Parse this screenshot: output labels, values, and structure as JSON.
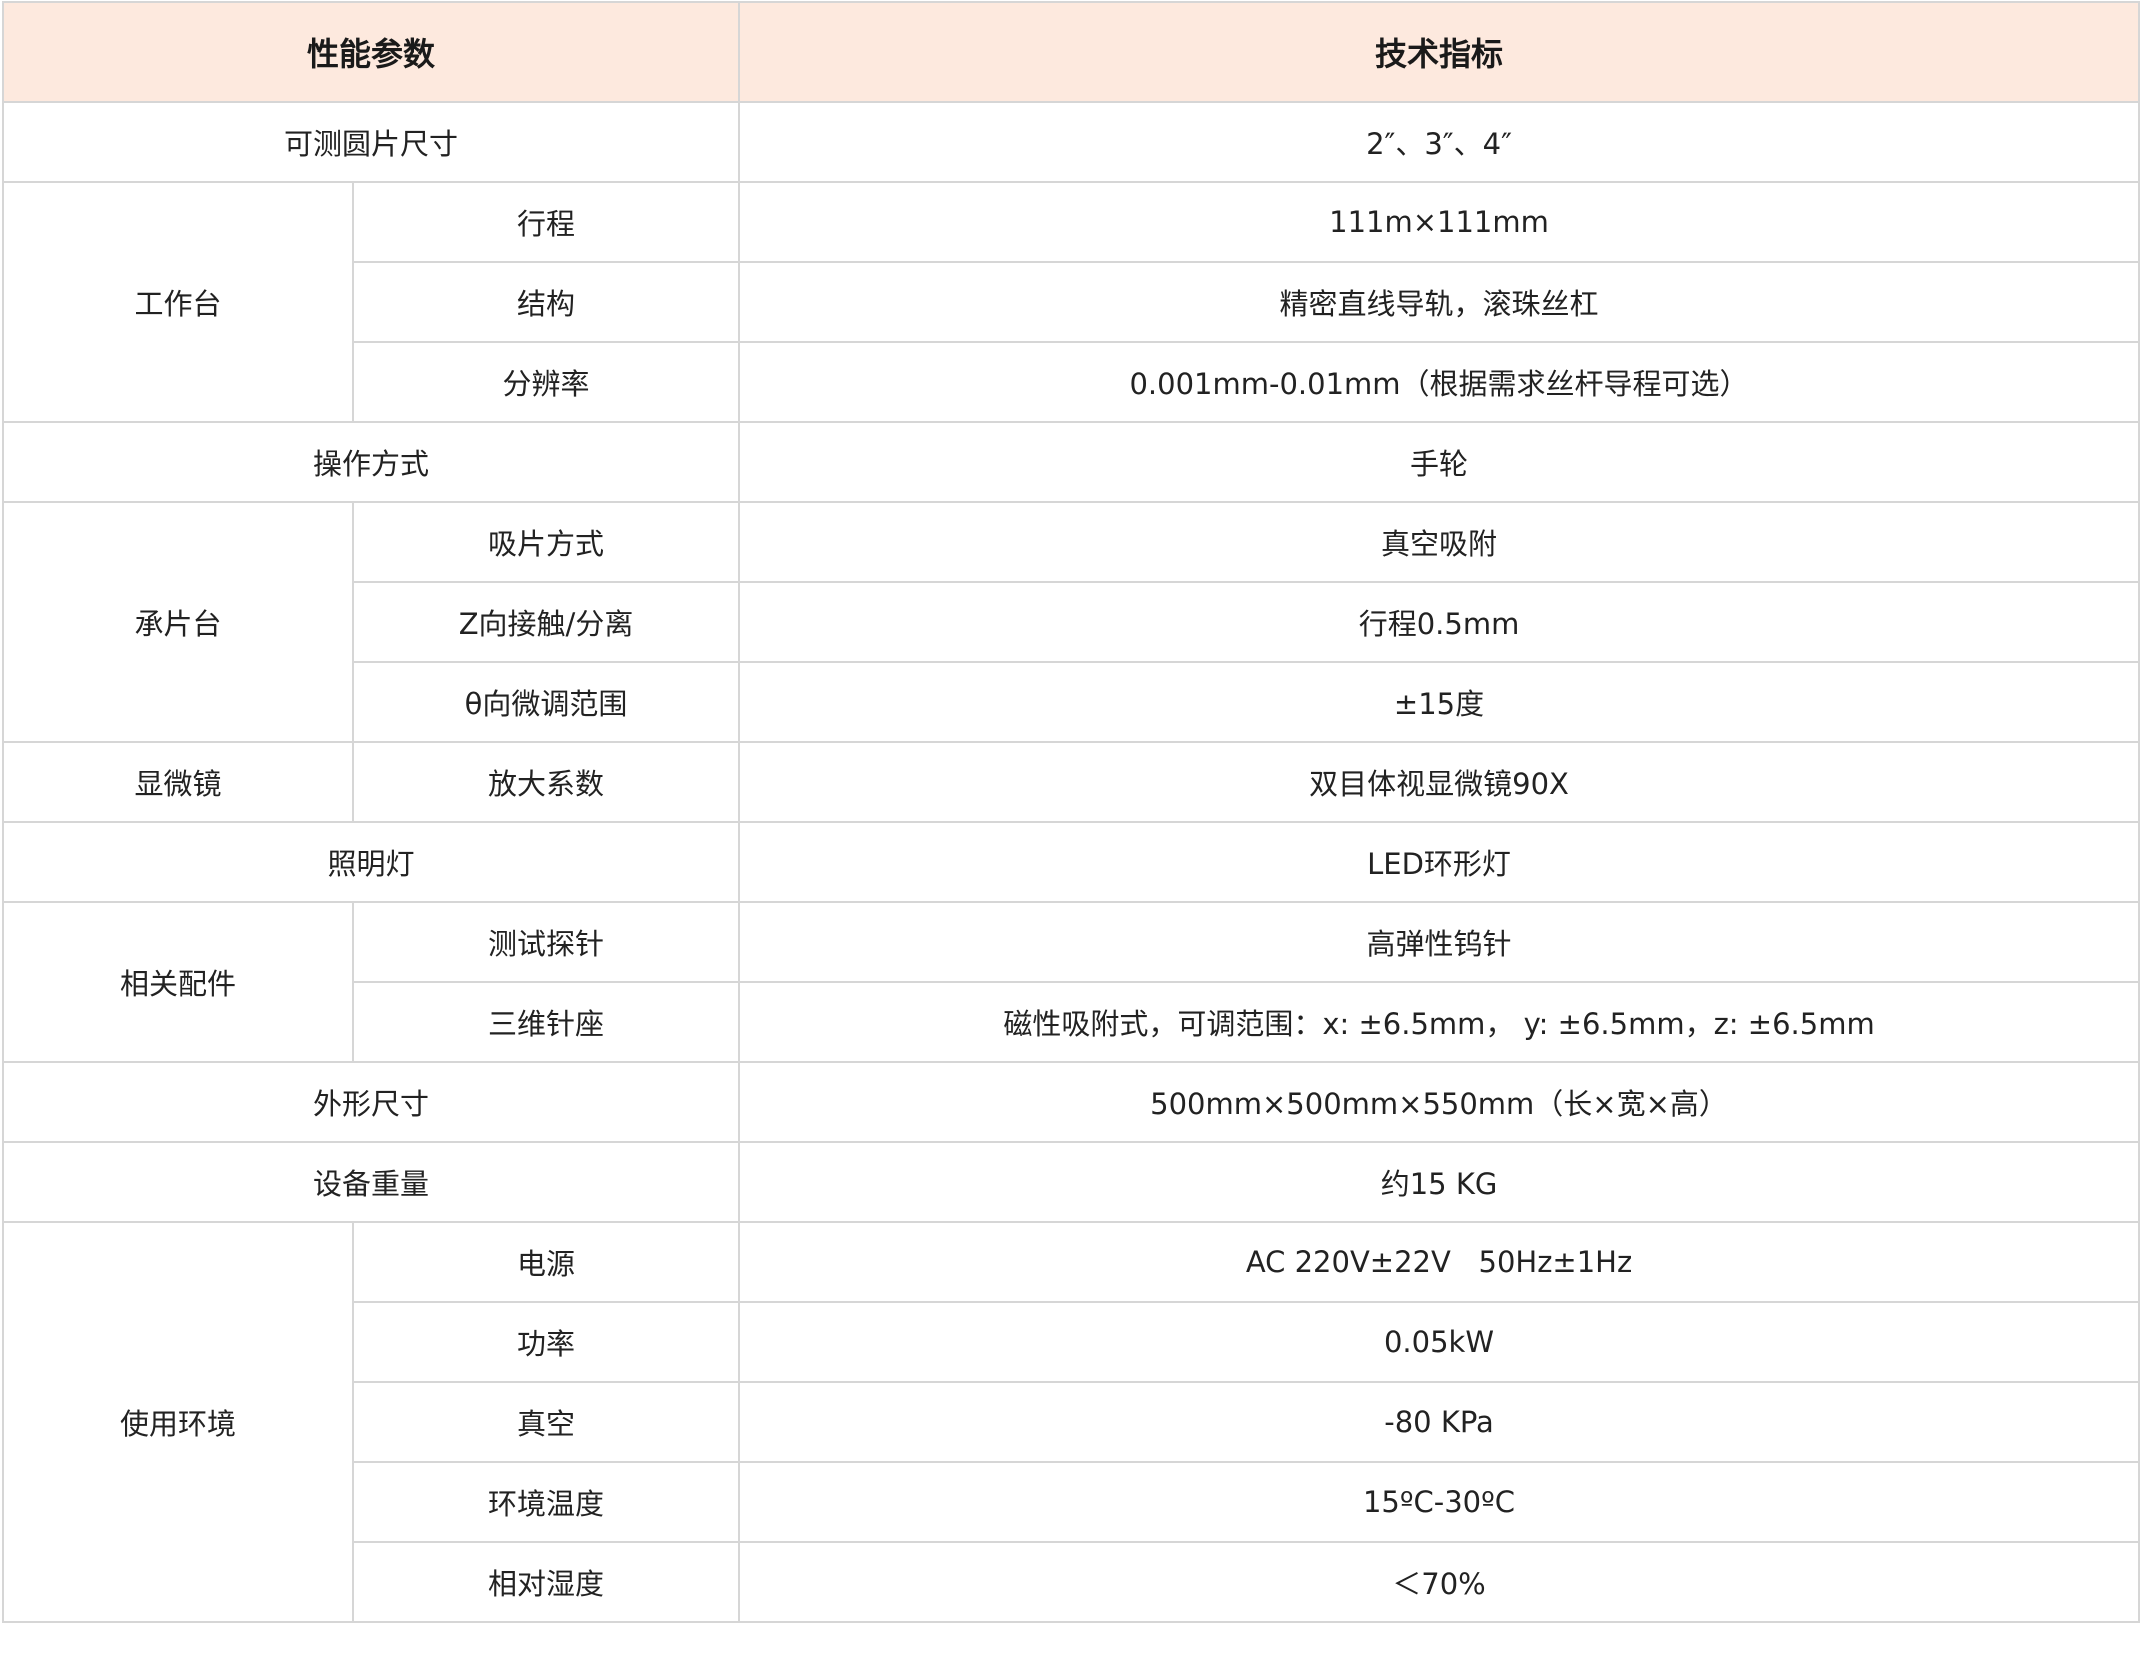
{
  "header": {
    "col1": "性能参数",
    "col2": "技术指标"
  },
  "rows": [
    {
      "group": "可测圆片尺寸",
      "sub": "",
      "value": "2″、3″、4″"
    },
    {
      "group": "工作台",
      "sub": "行程",
      "value": "111m×111mm"
    },
    {
      "group": "工作台",
      "sub": "结构",
      "value": "精密直线导轨，滚珠丝杠"
    },
    {
      "group": "工作台",
      "sub": "分辨率",
      "value": "0.001mm-0.01mm（根据需求丝杆导程可选）"
    },
    {
      "group": "操作方式",
      "sub": "",
      "value": "手轮"
    },
    {
      "group": "承片台",
      "sub": "吸片方式",
      "value": "真空吸附"
    },
    {
      "group": "承片台",
      "sub": "Z向接触/分离",
      "value": "行程0.5mm"
    },
    {
      "group": "承片台",
      "sub": "θ向微调范围",
      "value": "±15度"
    },
    {
      "group": "显微镜",
      "sub": "放大系数",
      "value": "双目体视显微镜90X"
    },
    {
      "group": "照明灯",
      "sub": "",
      "value": "LED环形灯"
    },
    {
      "group": "相关配件",
      "sub": "测试探针",
      "value": "高弹性钨针"
    },
    {
      "group": "相关配件",
      "sub": "三维针座",
      "value": "磁性吸附式，可调范围：x: ±6.5mm， y: ±6.5mm，z: ±6.5mm"
    },
    {
      "group": "外形尺寸",
      "sub": "",
      "value": "500mm×500mm×550mm（长×宽×高）"
    },
    {
      "group": "设备重量",
      "sub": "",
      "value": "约15 KG"
    },
    {
      "group": "使用环境",
      "sub": "电源",
      "value": "AC 220V±22V   50Hz±1Hz"
    },
    {
      "group": "使用环境",
      "sub": "功率",
      "value": "0.05kW"
    },
    {
      "group": "使用环境",
      "sub": "真空",
      "value": "-80 KPa"
    },
    {
      "group": "使用环境",
      "sub": "环境温度",
      "value": "15ºC-30ºC"
    },
    {
      "group": "使用环境",
      "sub": "相对湿度",
      "value": "＜70%"
    }
  ],
  "colors": {
    "header_bg": "#fde9de",
    "border": "#d6d6d6",
    "text": "#222222"
  }
}
